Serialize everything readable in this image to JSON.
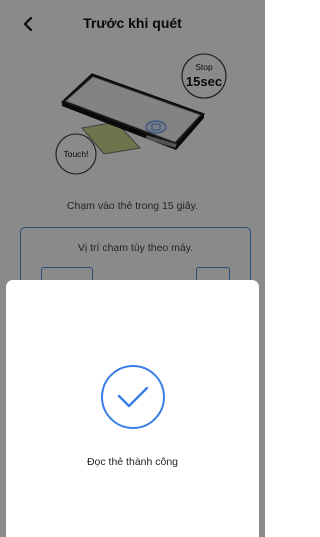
{
  "header": {
    "title": "Trước khi quét",
    "back_icon": "chevron-left-icon"
  },
  "illustration": {
    "stop_label": "Stop",
    "stop_time": "15sec",
    "touch_label": "Touch!"
  },
  "instruction": "Chạm vào thẻ trong 15 giây.",
  "position_hint": "Vị trí chạm tùy theo máy.",
  "result_sheet": {
    "icon": "check-circle-icon",
    "message": "Đọc thẻ thành công"
  },
  "colors": {
    "accent": "#3a7ee8",
    "overlay": "rgba(0,0,0,0.46)"
  }
}
